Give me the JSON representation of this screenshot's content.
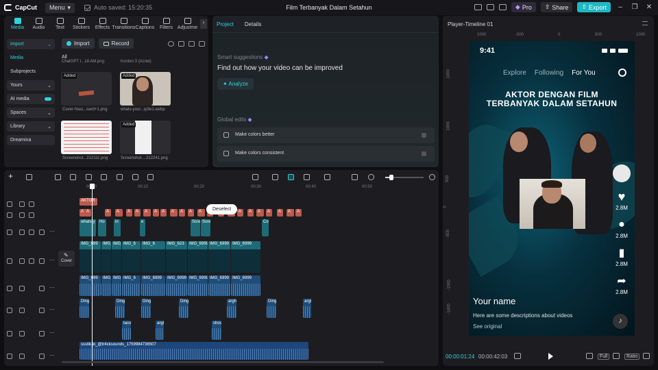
{
  "app": {
    "logo": "CapCut",
    "menu_label": "Menu",
    "autosave": "Auto saved: 15:20:35",
    "project_title": "Film Terbanyak Dalam Setahun",
    "pro_label": "Pro",
    "share_label": "Share",
    "export_label": "Export"
  },
  "media_panel": {
    "tabs": [
      {
        "label": "Media",
        "icon": "media-icon",
        "active": true
      },
      {
        "label": "Audio",
        "icon": "audio-icon"
      },
      {
        "label": "Text",
        "icon": "text-icon"
      },
      {
        "label": "Stickers",
        "icon": "stickers-icon"
      },
      {
        "label": "Effects",
        "icon": "effects-icon"
      },
      {
        "label": "Transitions",
        "icon": "transitions-icon"
      },
      {
        "label": "Captions",
        "icon": "captions-icon"
      },
      {
        "label": "Filters",
        "icon": "filters-icon"
      },
      {
        "label": "Adjustme",
        "icon": "adjustment-icon"
      }
    ],
    "nav": [
      {
        "label": "Import",
        "style": "boxed",
        "active": true,
        "caret": true
      },
      {
        "label": "Media",
        "style": "plain",
        "active": true
      },
      {
        "label": "Subprojects",
        "style": "plain"
      },
      {
        "label": "Yours",
        "style": "boxed",
        "caret": true
      },
      {
        "label": "AI media",
        "style": "boxed",
        "toggle": true
      },
      {
        "label": "Spaces",
        "style": "boxed",
        "caret": true
      },
      {
        "label": "Library",
        "style": "boxed",
        "caret": true
      },
      {
        "label": "Dreamina",
        "style": "boxed"
      }
    ],
    "import_label": "Import",
    "record_label": "Record",
    "filter_all": "All",
    "group_captions": [
      "ChatGPT I...18 AM.png",
      "Konten 3 (Azriel)"
    ],
    "items": [
      {
        "name": "Cover-Nasi...oard+1.png",
        "added": "Added"
      },
      {
        "name": "whats-your...ip3e1.webp",
        "added": "Added"
      },
      {
        "name": "Screenshot...212111.png",
        "added": ""
      },
      {
        "name": "Screenshot....212241.png",
        "added": "Added"
      }
    ]
  },
  "project_panel": {
    "tabs": [
      "Project",
      "Details"
    ],
    "smart_title": "Smart suggestions",
    "smart_sub": "Find out how your video can be improved",
    "analyze_label": "Analyze",
    "global_title": "Global edits",
    "global_items": [
      "Make colors better",
      "Make colors consistent"
    ]
  },
  "player": {
    "title": "Player-Timeline 01",
    "ruler_h": [
      "1000",
      "-500",
      "0",
      "500",
      "1000"
    ],
    "ruler_v": [
      "1400",
      "1000",
      "500",
      "0",
      "-500",
      "-1000",
      "-1400"
    ],
    "phone": {
      "time": "9:41",
      "nav": [
        "Explore",
        "Following",
        "For You"
      ],
      "headline_1": "AKTOR DENGAN FILM",
      "headline_2": "TERBANYAK DALAM SETAHUN",
      "counts": [
        "2.8M",
        "2.8M",
        "2.8M",
        "2.8M"
      ],
      "name": "Your name",
      "desc": "Here are some descriptions about videos",
      "see": "See original"
    },
    "timecode_current": "00:00:01:24",
    "timecode_total": "00:00:42:03",
    "full_label": "Full",
    "ratio_label": "Ratio"
  },
  "timeline": {
    "ruler": [
      "00:00",
      "00:10",
      "00:20",
      "00:30",
      "00:40",
      "00:50"
    ],
    "deselect_label": "Deselect",
    "cover_label": "Cover",
    "text_clip_1": "AKTOR",
    "text_clip_small": "A",
    "overlay_clips": [
      "whats-y",
      "Ho",
      "in",
      "e",
      "Scre",
      "Scre",
      "Cover-"
    ],
    "video_clips": [
      "IMG_699",
      "IMG_6999",
      "IMG_6",
      "IMG_6",
      "IMG_6",
      "IMG_623",
      "IMG_6999",
      "IMG_6999",
      "IMG_6999"
    ],
    "audio1_clips": [
      "IMG_699",
      "IMG_6999",
      "IMG_6999",
      "IMG_6",
      "IMG_6999",
      "IMG_6999",
      "IMG_6999",
      "IMG_6999",
      "IMG_6999"
    ],
    "audio2_clips": [
      "Ding",
      "Ding",
      "Ding",
      "Ding",
      "argh",
      "Ding",
      "argh"
    ],
    "audio3_clips": [
      "taco",
      "argh",
      "shoc"
    ],
    "music_clip": "ssstik.io_@tr4cksounds_1759984736507"
  }
}
